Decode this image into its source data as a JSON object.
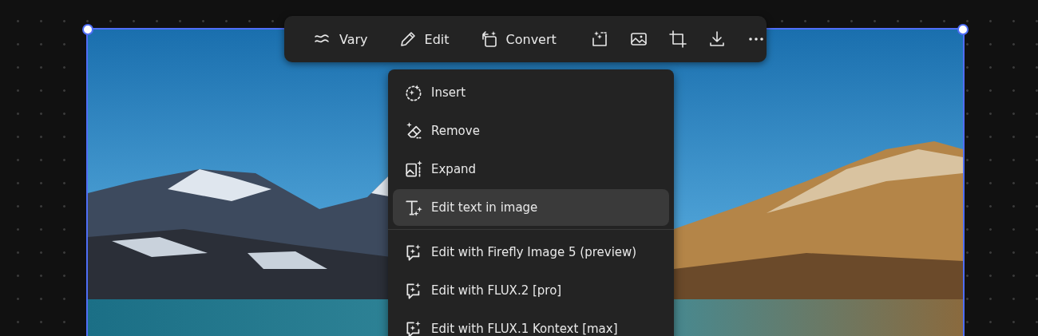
{
  "toolbar": {
    "actions": [
      {
        "label": "Vary"
      },
      {
        "label": "Edit"
      },
      {
        "label": "Convert"
      }
    ]
  },
  "menu": {
    "groups": [
      [
        {
          "label": "Insert",
          "selected": false
        },
        {
          "label": "Remove",
          "selected": false
        },
        {
          "label": "Expand",
          "selected": false
        },
        {
          "label": "Edit text in image",
          "selected": true
        }
      ],
      [
        {
          "label": "Edit with Firefly Image 5 (preview)",
          "selected": false
        },
        {
          "label": "Edit with FLUX.2 [pro]",
          "selected": false
        },
        {
          "label": "Edit with FLUX.1 Kontext [max]",
          "selected": false
        }
      ]
    ]
  },
  "canvas": {
    "image": {
      "kind": "picture",
      "selected": true
    }
  }
}
